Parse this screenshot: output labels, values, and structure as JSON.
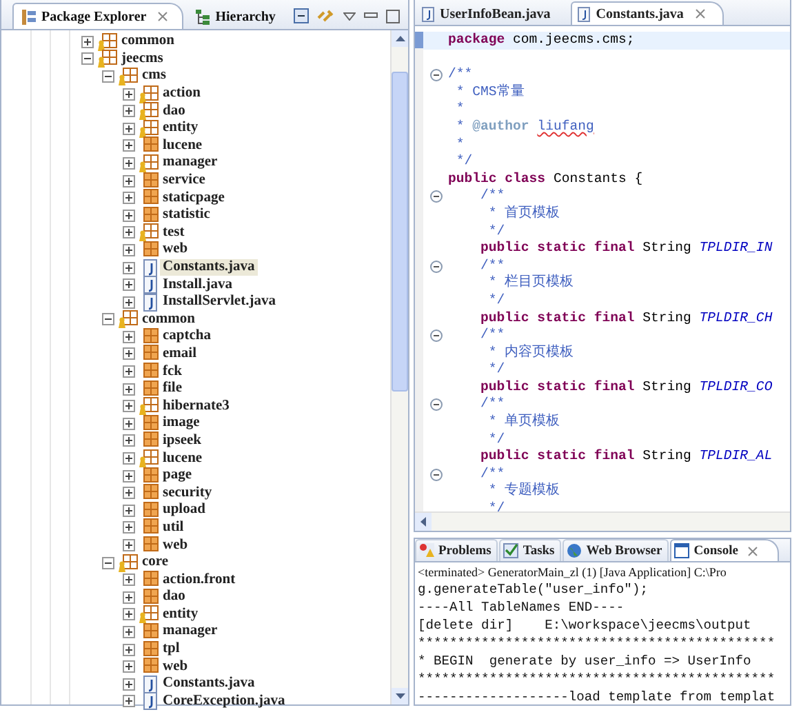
{
  "package_explorer": {
    "tabs": [
      {
        "label": "Package Explorer",
        "selected": true
      },
      {
        "label": "Hierarchy",
        "selected": false
      }
    ],
    "tree": [
      {
        "label": "common",
        "kind": "package",
        "expanded": false,
        "decorated": true,
        "selected": false
      },
      {
        "label": "jeecms",
        "kind": "package",
        "expanded": true,
        "decorated": true,
        "selected": false,
        "children": [
          {
            "label": "cms",
            "kind": "package",
            "expanded": true,
            "decorated": true,
            "selected": false,
            "children": [
              {
                "label": "action",
                "kind": "package",
                "expanded": false,
                "decorated": true,
                "selected": false
              },
              {
                "label": "dao",
                "kind": "package",
                "expanded": false,
                "decorated": true,
                "selected": false
              },
              {
                "label": "entity",
                "kind": "package",
                "expanded": false,
                "decorated": true,
                "selected": false
              },
              {
                "label": "lucene",
                "kind": "package",
                "expanded": false,
                "decorated": false,
                "selected": false
              },
              {
                "label": "manager",
                "kind": "package",
                "expanded": false,
                "decorated": true,
                "selected": false
              },
              {
                "label": "service",
                "kind": "package",
                "expanded": false,
                "decorated": false,
                "selected": false
              },
              {
                "label": "staticpage",
                "kind": "package",
                "expanded": false,
                "decorated": false,
                "selected": false
              },
              {
                "label": "statistic",
                "kind": "package",
                "expanded": false,
                "decorated": false,
                "selected": false
              },
              {
                "label": "test",
                "kind": "package",
                "expanded": false,
                "decorated": true,
                "selected": false
              },
              {
                "label": "web",
                "kind": "package",
                "expanded": false,
                "decorated": false,
                "selected": false
              },
              {
                "label": "Constants.java",
                "kind": "java",
                "expanded": false,
                "selected": true
              },
              {
                "label": "Install.java",
                "kind": "java",
                "expanded": false,
                "selected": false
              },
              {
                "label": "InstallServlet.java",
                "kind": "java",
                "expanded": false,
                "selected": false
              }
            ]
          },
          {
            "label": "common",
            "kind": "package",
            "expanded": true,
            "decorated": true,
            "selected": false,
            "children": [
              {
                "label": "captcha",
                "kind": "package",
                "expanded": false,
                "decorated": false,
                "selected": false
              },
              {
                "label": "email",
                "kind": "package",
                "expanded": false,
                "decorated": false,
                "selected": false
              },
              {
                "label": "fck",
                "kind": "package",
                "expanded": false,
                "decorated": false,
                "selected": false
              },
              {
                "label": "file",
                "kind": "package",
                "expanded": false,
                "decorated": false,
                "selected": false
              },
              {
                "label": "hibernate3",
                "kind": "package",
                "expanded": false,
                "decorated": true,
                "selected": false
              },
              {
                "label": "image",
                "kind": "package",
                "expanded": false,
                "decorated": false,
                "selected": false
              },
              {
                "label": "ipseek",
                "kind": "package",
                "expanded": false,
                "decorated": false,
                "selected": false
              },
              {
                "label": "lucene",
                "kind": "package",
                "expanded": false,
                "decorated": true,
                "selected": false
              },
              {
                "label": "page",
                "kind": "package",
                "expanded": false,
                "decorated": false,
                "selected": false
              },
              {
                "label": "security",
                "kind": "package",
                "expanded": false,
                "decorated": false,
                "selected": false
              },
              {
                "label": "upload",
                "kind": "package",
                "expanded": false,
                "decorated": false,
                "selected": false
              },
              {
                "label": "util",
                "kind": "package",
                "expanded": false,
                "decorated": false,
                "selected": false
              },
              {
                "label": "web",
                "kind": "package",
                "expanded": false,
                "decorated": false,
                "selected": false
              }
            ]
          },
          {
            "label": "core",
            "kind": "package",
            "expanded": true,
            "decorated": true,
            "selected": false,
            "children": [
              {
                "label": "action.front",
                "kind": "package",
                "expanded": false,
                "decorated": false,
                "selected": false
              },
              {
                "label": "dao",
                "kind": "package",
                "expanded": false,
                "decorated": false,
                "selected": false
              },
              {
                "label": "entity",
                "kind": "package",
                "expanded": false,
                "decorated": true,
                "selected": false
              },
              {
                "label": "manager",
                "kind": "package",
                "expanded": false,
                "decorated": false,
                "selected": false
              },
              {
                "label": "tpl",
                "kind": "package",
                "expanded": false,
                "decorated": false,
                "selected": false
              },
              {
                "label": "web",
                "kind": "package",
                "expanded": false,
                "decorated": false,
                "selected": false
              },
              {
                "label": "Constants.java",
                "kind": "java",
                "expanded": false,
                "selected": false
              },
              {
                "label": "CoreException.java",
                "kind": "java",
                "expanded": false,
                "selected": false
              }
            ]
          }
        ]
      }
    ]
  },
  "editor": {
    "tabs": [
      {
        "label": "UserInfoBean.java",
        "selected": false
      },
      {
        "label": "Constants.java",
        "selected": true
      }
    ],
    "lines": [
      {
        "fold": false,
        "current": true,
        "segments": [
          {
            "text": "package",
            "kind": "keyword"
          },
          {
            "text": " com.jeecms.cms;",
            "kind": "plain"
          }
        ]
      },
      {
        "fold": false,
        "current": false
      },
      {
        "fold": true,
        "current": false,
        "segments": [
          {
            "text": "/**",
            "kind": "comment"
          }
        ]
      },
      {
        "fold": false,
        "current": false,
        "segments": [
          {
            "text": " * CMS常量",
            "kind": "comment"
          }
        ]
      },
      {
        "fold": false,
        "current": false,
        "segments": [
          {
            "text": " *",
            "kind": "comment"
          }
        ]
      },
      {
        "fold": false,
        "current": false,
        "segments": [
          {
            "text": " * ",
            "kind": "comment"
          },
          {
            "text": "@author ",
            "kind": "tag"
          },
          {
            "text": "liufang",
            "kind": "misspelled"
          }
        ]
      },
      {
        "fold": false,
        "current": false,
        "segments": [
          {
            "text": " *",
            "kind": "comment"
          }
        ]
      },
      {
        "fold": false,
        "current": false,
        "segments": [
          {
            "text": " */",
            "kind": "comment"
          }
        ]
      },
      {
        "fold": false,
        "current": false,
        "segments": [
          {
            "text": "public class",
            "kind": "keyword"
          },
          {
            "text": " Constants {",
            "kind": "plain"
          }
        ]
      },
      {
        "fold": true,
        "current": false,
        "segments": [
          {
            "text": "    /**",
            "kind": "comment"
          }
        ]
      },
      {
        "fold": false,
        "current": false,
        "segments": [
          {
            "text": "     * 首页模板",
            "kind": "comment"
          }
        ]
      },
      {
        "fold": false,
        "current": false,
        "segments": [
          {
            "text": "     */",
            "kind": "comment"
          }
        ]
      },
      {
        "fold": false,
        "current": false,
        "segments": [
          {
            "text": "    public static final",
            "kind": "keyword"
          },
          {
            "text": " String ",
            "kind": "plain"
          },
          {
            "text": "TPLDIR_IN",
            "kind": "constant"
          }
        ]
      },
      {
        "fold": true,
        "current": false,
        "segments": [
          {
            "text": "    /**",
            "kind": "comment"
          }
        ]
      },
      {
        "fold": false,
        "current": false,
        "segments": [
          {
            "text": "     * 栏目页模板",
            "kind": "comment"
          }
        ]
      },
      {
        "fold": false,
        "current": false,
        "segments": [
          {
            "text": "     */",
            "kind": "comment"
          }
        ]
      },
      {
        "fold": false,
        "current": false,
        "segments": [
          {
            "text": "    public static final",
            "kind": "keyword"
          },
          {
            "text": " String ",
            "kind": "plain"
          },
          {
            "text": "TPLDIR_CH",
            "kind": "constant"
          }
        ]
      },
      {
        "fold": true,
        "current": false,
        "segments": [
          {
            "text": "    /**",
            "kind": "comment"
          }
        ]
      },
      {
        "fold": false,
        "current": false,
        "segments": [
          {
            "text": "     * 内容页模板",
            "kind": "comment"
          }
        ]
      },
      {
        "fold": false,
        "current": false,
        "segments": [
          {
            "text": "     */",
            "kind": "comment"
          }
        ]
      },
      {
        "fold": false,
        "current": false,
        "segments": [
          {
            "text": "    public static final",
            "kind": "keyword"
          },
          {
            "text": " String ",
            "kind": "plain"
          },
          {
            "text": "TPLDIR_CO",
            "kind": "constant"
          }
        ]
      },
      {
        "fold": true,
        "current": false,
        "segments": [
          {
            "text": "    /**",
            "kind": "comment"
          }
        ]
      },
      {
        "fold": false,
        "current": false,
        "segments": [
          {
            "text": "     * 单页模板",
            "kind": "comment"
          }
        ]
      },
      {
        "fold": false,
        "current": false,
        "segments": [
          {
            "text": "     */",
            "kind": "comment"
          }
        ]
      },
      {
        "fold": false,
        "current": false,
        "segments": [
          {
            "text": "    public static final",
            "kind": "keyword"
          },
          {
            "text": " String ",
            "kind": "plain"
          },
          {
            "text": "TPLDIR_AL",
            "kind": "constant"
          }
        ]
      },
      {
        "fold": true,
        "current": false,
        "segments": [
          {
            "text": "    /**",
            "kind": "comment"
          }
        ]
      },
      {
        "fold": false,
        "current": false,
        "segments": [
          {
            "text": "     * 专题模板",
            "kind": "comment"
          }
        ]
      },
      {
        "fold": false,
        "current": false,
        "segments": [
          {
            "text": "     */",
            "kind": "comment"
          }
        ]
      }
    ]
  },
  "bottom_panel": {
    "tabs": [
      {
        "label": "Problems",
        "selected": false
      },
      {
        "label": "Tasks",
        "selected": false
      },
      {
        "label": "Web Browser",
        "selected": false
      },
      {
        "label": "Console",
        "selected": true
      }
    ],
    "console": [
      {
        "kind": "header",
        "text": "<terminated> GeneratorMain_zl (1) [Java Application] C:\\Pro"
      },
      {
        "kind": "output",
        "text": "g.generateTable(\"user_info\");"
      },
      {
        "kind": "output",
        "text": "----All TableNames END----"
      },
      {
        "kind": "output",
        "text": "[delete dir]    E:\\workspace\\jeecms\\output"
      },
      {
        "kind": "output",
        "text": "*********************************************"
      },
      {
        "kind": "output",
        "text": "* BEGIN  generate by user_info => UserInfo"
      },
      {
        "kind": "output",
        "text": "*********************************************"
      },
      {
        "kind": "output",
        "text": "-------------------load template from templat"
      }
    ]
  }
}
